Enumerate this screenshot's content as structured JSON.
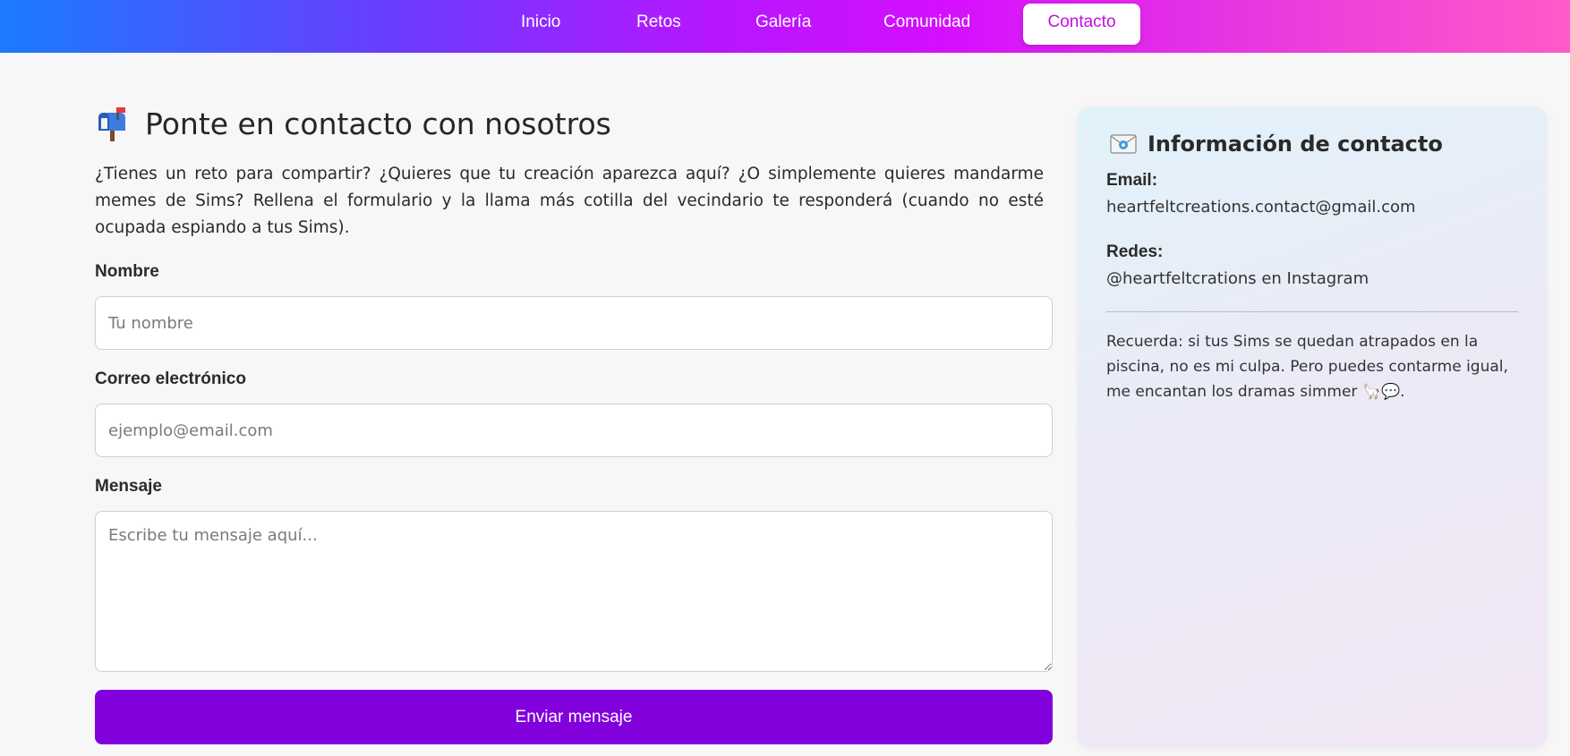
{
  "nav": {
    "items": [
      {
        "label": "Inicio"
      },
      {
        "label": "Retos"
      },
      {
        "label": "Galería"
      },
      {
        "label": "Comunidad"
      },
      {
        "label": "Contacto"
      }
    ],
    "active": "Contacto",
    "gradient_colors": [
      "#1a7cff",
      "#6a3cff",
      "#d40fff",
      "#ff5ac8"
    ],
    "active_text_color": "#c40fe0"
  },
  "main": {
    "title_icon": "mailbox-icon",
    "title": "Ponte en contacto con nosotros",
    "intro": "¿Tienes un reto para compartir? ¿Quieres que tu creación aparezca aquí? ¿O simplemente quieres mandarme memes de Sims? Rellena el formulario y la llama más cotilla del vecindario te responderá (cuando no esté ocupada espiando a tus Sims).",
    "form": {
      "name_label": "Nombre",
      "name_value": "",
      "name_placeholder": "Tu nombre",
      "email_label": "Correo electrónico",
      "email_value": "",
      "email_placeholder": "ejemplo@email.com",
      "message_label": "Mensaje",
      "message_value": "",
      "message_placeholder": "Escribe tu mensaje aquí...",
      "submit_label": "Enviar mensaje",
      "submit_color": "#8200dc"
    }
  },
  "contact_card": {
    "title_icon": "envelope-icon",
    "title": "Información de contacto",
    "email_label": "Email:",
    "email_value": "heartfeltcreations.contact@gmail.com",
    "social_label": "Redes:",
    "social_value": "@heartfeltcrations en Instagram",
    "note": "Recuerda: si tus Sims se quedan atrapados en la piscina, no es mi culpa. Pero puedes contarme igual, me encantan los dramas simmer 🦙💬."
  }
}
